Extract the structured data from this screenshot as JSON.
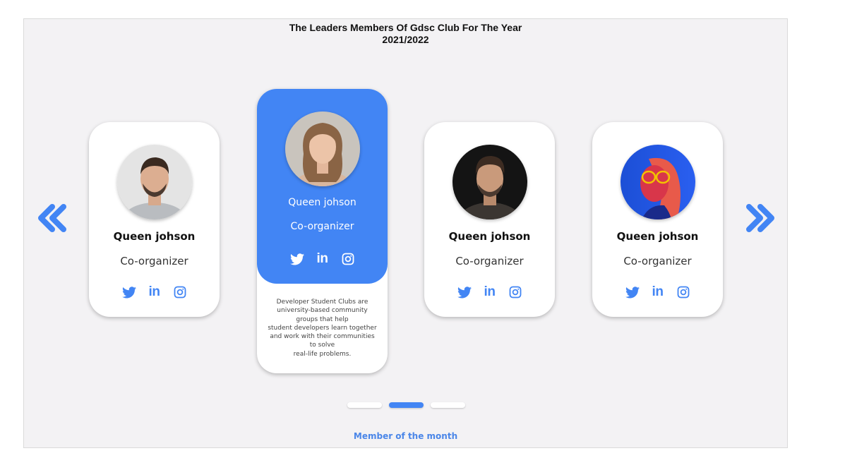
{
  "page": {
    "title_line1": "The Leaders Members Of Gdsc Club For The Year",
    "title_line2": "2021/2022"
  },
  "colors": {
    "accent": "#4285f4",
    "background": "#f3f2f4",
    "card": "#ffffff"
  },
  "carousel": {
    "prev_icon": "double-chevron-left-icon",
    "next_icon": "double-chevron-right-icon",
    "cards": [
      {
        "name": "Queen johson",
        "role": "Co-organizer",
        "photo": "man-portrait-beard"
      },
      {
        "name": "Queen johson",
        "role": "Co-organizer",
        "photo": "woman-portrait-curly-hair",
        "featured": true,
        "description": "Developer Student Clubs are\nuniversity-based community\ngroups that help\nstudent developers learn together\nand work with their communities\nto solve\nreal-life problems."
      },
      {
        "name": "Queen johson",
        "role": "Co-organizer",
        "photo": "man-portrait-dark-background"
      },
      {
        "name": "Queen johson",
        "role": "Co-organizer",
        "photo": "woman-portrait-neon-glasses"
      }
    ],
    "socials": [
      "twitter-icon",
      "linkedin-icon",
      "instagram-icon"
    ],
    "linkedin_text": "in",
    "pagination": {
      "count": 3,
      "active_index": 1
    }
  },
  "footer": {
    "member_of_month": "Member of the month"
  }
}
